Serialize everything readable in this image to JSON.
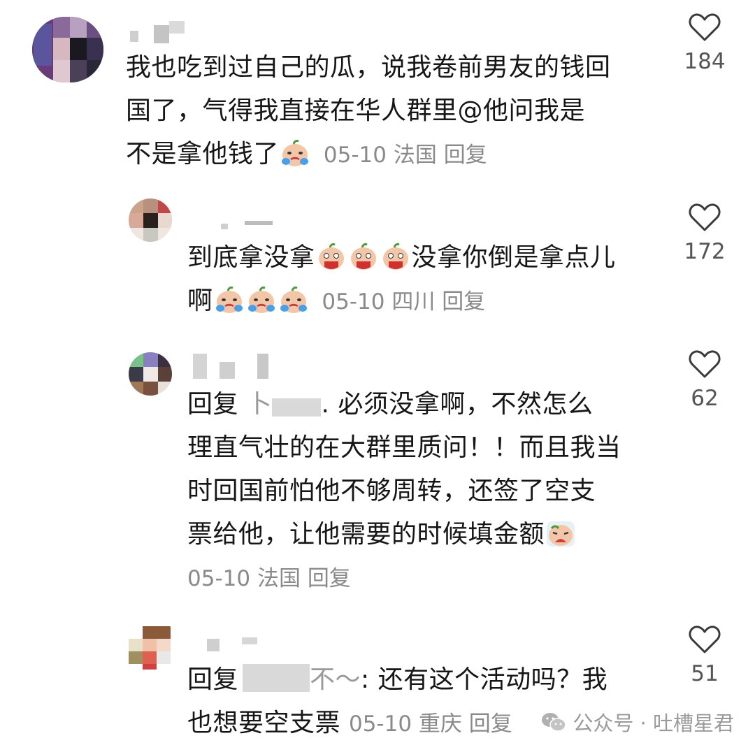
{
  "comments": [
    {
      "text_lines": [
        "我也吃到过自己的瓜，说我卷前男友的钱回",
        "国了，气得我直接在华人群里@他问我是",
        "不是拿他钱了"
      ],
      "date": "05-10",
      "location": "法国",
      "reply_label": "回复",
      "likes": "184"
    },
    {
      "text_part1": "到底拿没拿",
      "text_part2": "没拿你倒是拿点儿",
      "text_part3": "啊",
      "date": "05-10",
      "location": "四川",
      "reply_label": "回复",
      "likes": "172"
    },
    {
      "prefix": "回复",
      "mention_visible": "卜",
      "mention_end": ".",
      "text_first": "必须没拿啊，不然怎么",
      "text_lines": [
        "理直气壮的在大群里质问！！而且我当",
        "时回国前怕他不够周转，还签了空支",
        "票给他，让他需要的时候填金额"
      ],
      "date": "05-10",
      "location": "法国",
      "reply_label": "回复",
      "likes": "62"
    },
    {
      "prefix": "回复",
      "mention_visible": "不～",
      "text_first": ": 还有这个活动吗？我",
      "text_second": "也想要空支票",
      "date": "05-10",
      "location": "重庆",
      "reply_label": "回复",
      "likes": "51"
    }
  ],
  "watermark": {
    "label": "公众号 · 吐槽星君",
    "icon": "wechat-icon"
  },
  "colors": {
    "text": "#161616",
    "meta": "#8a8a8a",
    "like_icon": "#3a3a3a"
  }
}
